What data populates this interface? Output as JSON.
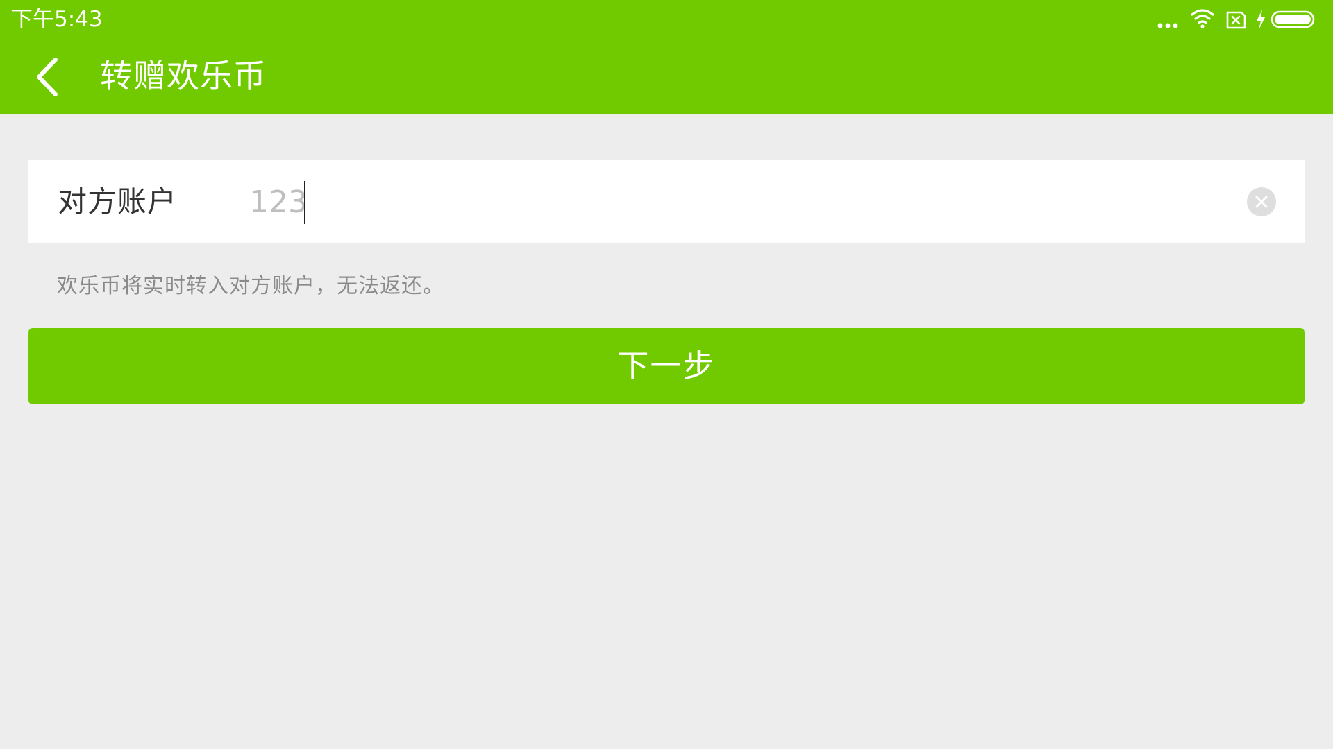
{
  "status_bar": {
    "time": "下午5:43",
    "icons": [
      "more-dots-icon",
      "wifi-icon",
      "sim-blocked-icon",
      "charging-bolt-icon",
      "battery-icon"
    ]
  },
  "toolbar": {
    "back_icon": "chevron-left-icon",
    "title": "转赠欢乐币"
  },
  "form": {
    "account_label": "对方账户",
    "account_value": "123",
    "clear_icon": "close-circle-icon",
    "hint": "欢乐币将实时转入对方账户，无法返还。"
  },
  "actions": {
    "next_label": "下一步"
  },
  "colors": {
    "accent": "#71ca00",
    "background": "#ededed",
    "card": "#ffffff",
    "label_text": "#333333",
    "input_text": "#bfbfbf",
    "hint_text": "#8a8a8a"
  }
}
